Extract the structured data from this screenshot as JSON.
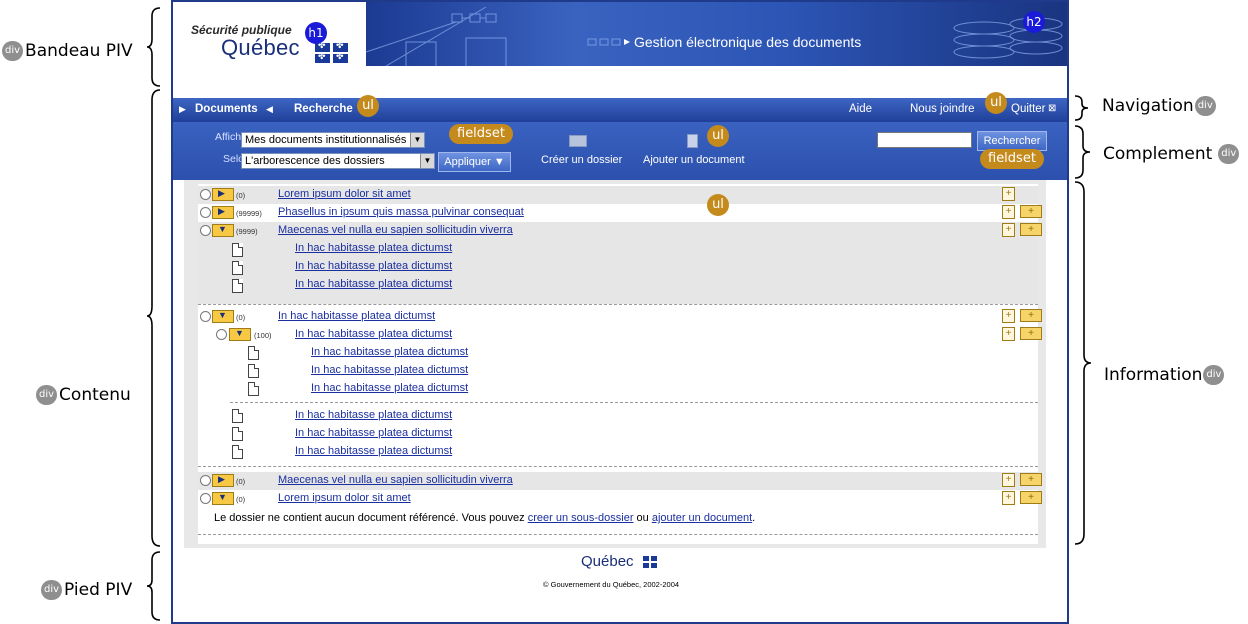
{
  "annotations": {
    "bandeau": {
      "tag": "div",
      "label": "Bandeau PIV"
    },
    "contenu": {
      "tag": "div",
      "label": "Contenu"
    },
    "pied": {
      "tag": "div",
      "label": "Pied PIV"
    },
    "navigation": {
      "tag": "div",
      "label": "Navigation"
    },
    "complement": {
      "tag": "div",
      "label": "Complement"
    },
    "information": {
      "tag": "div",
      "label": "Information"
    }
  },
  "badges": {
    "h1": "h1",
    "h2": "h2",
    "ul_nav_left": "ul",
    "ul_nav_right": "ul",
    "fieldset_left": "fieldset",
    "ul_comp": "ul",
    "fieldset_right": "fieldset",
    "ul_content": "ul"
  },
  "banner": {
    "logo_line1": "Sécurité publique",
    "logo_line2": "Québec",
    "title": "Gestion électronique des documents",
    "bg_color": "#2c55b5"
  },
  "nav": {
    "documents": "Documents",
    "recherche": "Recherche",
    "aide": "Aide",
    "nous_joindre": "Nous joindre",
    "quitter": "Quitter",
    "bg_color": "#2f52ad"
  },
  "complement": {
    "afficher_label": "Afficher",
    "afficher_value": "Mes documents institutionnalisés",
    "selon_label": "Selon",
    "selon_value": "L'arborescence des dossiers",
    "appliquer": "Appliquer",
    "creer_dossier": "Créer un dossier",
    "ajouter_document": "Ajouter un document",
    "search_value": "",
    "rechercher": "Rechercher"
  },
  "tree": {
    "r1": {
      "count": "(0)",
      "label": "Lorem ipsum dolor sit amet"
    },
    "r2": {
      "count": "(99999)",
      "label": "Phasellus in ipsum quis massa pulvinar consequat"
    },
    "r3": {
      "count": "(9999)",
      "label": "Maecenas vel nulla eu sapien sollicitudin viverra"
    },
    "r3_docs": [
      "In hac habitasse platea dictumst",
      "In hac habitasse platea dictumst",
      "In hac habitasse platea dictumst"
    ],
    "r4": {
      "count": "(0)",
      "label": "In hac habitasse platea dictumst"
    },
    "r4_sub": {
      "count": "(100)",
      "label": "In hac habitasse platea dictumst"
    },
    "r4_sub_docs": [
      "In hac habitasse platea dictumst",
      "In hac habitasse platea dictumst",
      "In hac habitasse platea dictumst"
    ],
    "r4_docs": [
      "In hac habitasse platea dictumst",
      "In hac habitasse platea dictumst",
      "In hac habitasse platea dictumst"
    ],
    "r5": {
      "count": "(0)",
      "label": "Maecenas vel nulla eu sapien sollicitudin viverra"
    },
    "r6": {
      "count": "(0)",
      "label": "Lorem ipsum dolor sit amet"
    },
    "note_pre": "Le dossier ne contient aucun document référencé. Vous pouvez ",
    "note_link1": "creer un sous-dossier",
    "note_mid": " ou ",
    "note_link2": "ajouter un document",
    "note_post": "."
  },
  "footer": {
    "logo": "Québec",
    "copyright": "© Gouvernement du Québec, 2002-2004"
  }
}
